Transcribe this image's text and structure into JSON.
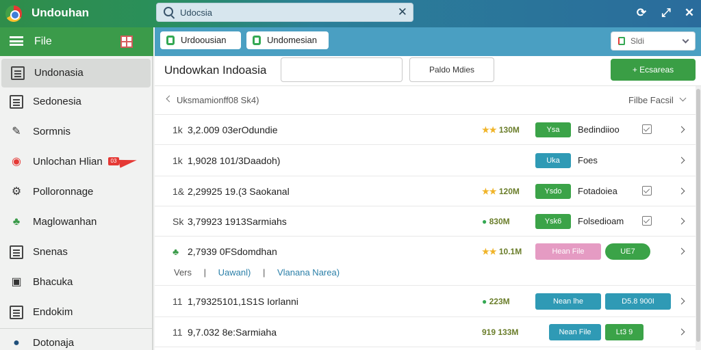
{
  "window": {
    "title": "Undouhan",
    "search_value": "Udocsia",
    "buttons": {
      "refresh": "⟳",
      "resize": "⤢",
      "close": "✕"
    }
  },
  "sidebar": {
    "header_label": "File",
    "items": [
      {
        "label": "Undonasia",
        "icon": "document-icon"
      },
      {
        "label": "Sedonesia",
        "icon": "document-icon"
      },
      {
        "label": "Sormnis",
        "icon": "pen-icon"
      },
      {
        "label": "Unlochan Hlian",
        "icon": "app-icon",
        "badge": "03"
      },
      {
        "label": "Polloronnage",
        "icon": "gear-icon"
      },
      {
        "label": "Maglowanhan",
        "icon": "clover-icon"
      },
      {
        "label": "Snenas",
        "icon": "document-icon"
      },
      {
        "label": "Bhacuka",
        "icon": "image-icon"
      },
      {
        "label": "Endokim",
        "icon": "document-icon"
      },
      {
        "label": "Dotonaja",
        "icon": "info-icon"
      }
    ]
  },
  "tabs": [
    {
      "label": "Urdoousian"
    },
    {
      "label": "Undomesian"
    }
  ],
  "select": {
    "value": "Sldi"
  },
  "toolbar": {
    "title": "Undowkan Indoasia",
    "input_value": "",
    "button_label": "Paldo Mdies",
    "primary_label": "+ Ecsareas"
  },
  "list": {
    "header_text": "Uksmamionff08 Sk4)",
    "filter_label": "Filbe Facsil",
    "rows": [
      {
        "prefix": "1k",
        "text": "3,2.009 03erOdundie",
        "size_icon": "★★",
        "size": "130M",
        "chip": "Ysa",
        "chip_color": "green",
        "status": "Bedindiioo",
        "check": true
      },
      {
        "prefix": "1k",
        "text": "1,9028 101/3Daadoh)",
        "size_icon": "",
        "size": "",
        "chip": "Uka",
        "chip_color": "teal",
        "status": "Foes",
        "check": false
      },
      {
        "prefix": "1&",
        "text": "2,29925 19.(3 Saokanal",
        "size_icon": "★★",
        "size": "120M",
        "chip": "Ysdo",
        "chip_color": "green",
        "status": "Fotadoiea",
        "check": true
      },
      {
        "prefix": "Sk",
        "text": "3,79923 1913Sarmiahs",
        "size_icon": "●",
        "size": "830M",
        "chip": "Ysk6",
        "chip_color": "green",
        "status": "Folsedioam",
        "check": true
      },
      {
        "prefix": "♣",
        "text": "2,7939 0FSdomdhan",
        "size_icon": "★★",
        "size": "10.1M",
        "chip": "Hean File",
        "chip_color": "pink",
        "status": "",
        "chip2": "UE7",
        "chip2_color": "green",
        "check": false
      },
      {
        "prefix": "11",
        "text": "1,79325101,1S1S Iorlanni",
        "size_icon": "●",
        "size": "223M",
        "chip": "Nean lhe",
        "chip_color": "teal",
        "status": "",
        "chip2": "D5.8 900I",
        "chip2_color": "teal",
        "check": false
      },
      {
        "prefix": "11",
        "text": "9,7.032 8e:Sarmiaha",
        "size_icon": "",
        "size": "919 133M",
        "chip": "Nean File",
        "chip_color": "teal",
        "status": "",
        "chip2": "Lt3 9",
        "chip2_color": "green",
        "check": false
      }
    ],
    "sub_line": {
      "label": "Vers",
      "link1": "Uawanl)",
      "link2": "Vlanana Narea)"
    }
  },
  "colors": {
    "title_gradient_start": "#2f8d4a",
    "title_gradient_end": "#2a6c9c",
    "sidebar_header": "#3b9b4a",
    "tabbar": "#4a9fc2",
    "primary": "#3a9e45"
  }
}
